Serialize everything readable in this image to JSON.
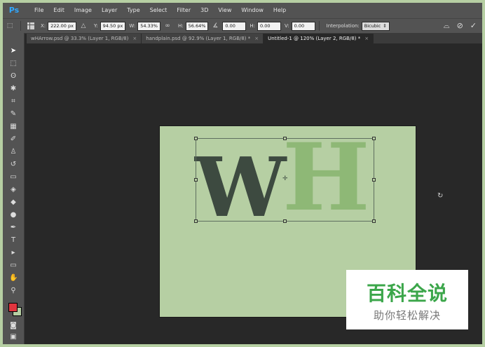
{
  "app": {
    "logo": "Ps"
  },
  "menu": [
    "File",
    "Edit",
    "Image",
    "Layer",
    "Type",
    "Select",
    "Filter",
    "3D",
    "View",
    "Window",
    "Help"
  ],
  "options": {
    "x_label": "X:",
    "x_value": "222.00 px",
    "y_label": "Y:",
    "y_value": "94.50 px",
    "w_label": "W:",
    "w_value": "54.33%",
    "h_label": "H:",
    "h_value": "56.64%",
    "angle_value": "0.00",
    "hskew_label": "H:",
    "hskew_value": "0.00",
    "vskew_label": "V:",
    "vskew_value": "0.00",
    "interpolation_label": "Interpolation:",
    "interpolation_value": "Bicubic"
  },
  "tabs": [
    {
      "label": "wHArrow.psd @ 33.3% (Layer 1, RGB/8)",
      "close": "×"
    },
    {
      "label": "handplain.psd @ 92.9% (Layer 1, RGB/8) *",
      "close": "×"
    },
    {
      "label": "Untitled-1 @ 120% (Layer 2, RGB/8) *",
      "close": "×"
    }
  ],
  "canvas": {
    "letter_w": "W",
    "letter_h": "H",
    "background": "#b6cfa3",
    "w_color": "#3d4a40",
    "h_color": "#8eb876"
  },
  "colors": {
    "foreground": "#e0353e",
    "background": "#b6cfa3"
  },
  "watermark": {
    "title": "百科全说",
    "subtitle": "助你轻松解决"
  }
}
